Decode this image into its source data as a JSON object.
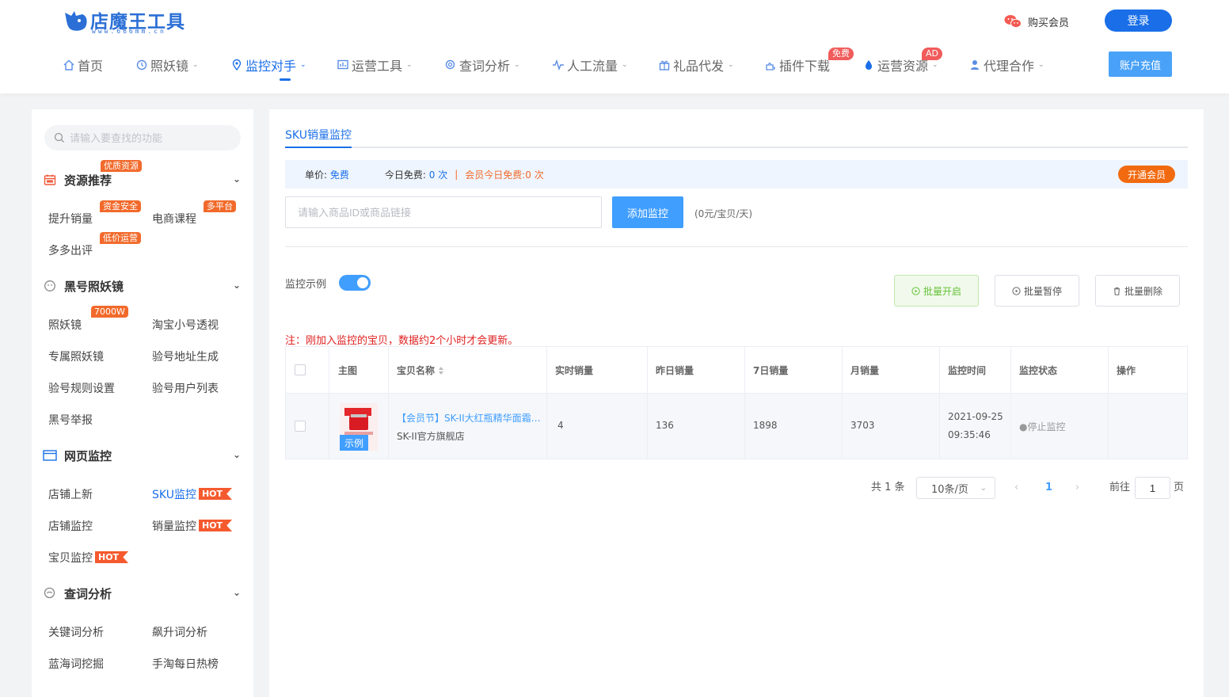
{
  "header": {
    "logo_text": "店魔王工具",
    "logo_url": "www.666mm.cn",
    "buy_vip": "购买会员",
    "login": "登录",
    "recharge": "账户充值",
    "nav": [
      {
        "label": "首页",
        "icon": "home-icon"
      },
      {
        "label": "照妖镜",
        "icon": "mirror-icon"
      },
      {
        "label": "监控对手",
        "icon": "location-icon",
        "active": true
      },
      {
        "label": "运营工具",
        "icon": "chart-icon"
      },
      {
        "label": "查词分析",
        "icon": "search-word-icon"
      },
      {
        "label": "人工流量",
        "icon": "pulse-icon"
      },
      {
        "label": "礼品代发",
        "icon": "gift-icon"
      },
      {
        "label": "插件下载",
        "icon": "puzzle-icon",
        "badge": "免费"
      },
      {
        "label": "运营资源",
        "icon": "drop-icon",
        "badge": "AD"
      },
      {
        "label": "代理合作",
        "icon": "person-icon"
      }
    ]
  },
  "sidebar": {
    "search_placeholder": "请输入要查找的功能",
    "sections": [
      {
        "title": "资源推荐",
        "tag": "优质资源",
        "icon": "calendar-icon"
      },
      {
        "title": "黑号照妖镜",
        "icon": "face-icon"
      },
      {
        "title": "网页监控",
        "icon": "window-icon"
      },
      {
        "title": "查词分析",
        "icon": "magnify-icon"
      }
    ],
    "links": {
      "tsxl": "提升销量",
      "tsxl_tag": "资金安全",
      "dskc": "电商课程",
      "dskc_tag": "多平台",
      "ddcp": "多多出评",
      "ddcp_tag": "低价运营",
      "zyj": "照妖镜",
      "zyj_tag": "7000W",
      "tbxh": "淘宝小号透视",
      "zszyj": "专属照妖镜",
      "yhdz": "验号地址生成",
      "yhgz": "验号规则设置",
      "yhyh": "验号用户列表",
      "hhjb": "黑号举报",
      "dpsx": "店铺上新",
      "skujk": "SKU监控",
      "dpjk": "店铺监控",
      "xljk": "销量监控",
      "bbjk": "宝贝监控",
      "gjc": "关键词分析",
      "bsc": "飙升词分析",
      "lhc": "蓝海词挖掘",
      "stmr": "手淘每日热榜",
      "hot": "HOT"
    }
  },
  "main": {
    "tab": "SKU销量监控",
    "info": {
      "unit_label": "单价:",
      "unit_value": "免费",
      "today_label": "今日免费:",
      "today_value": "0 次",
      "sep": "|",
      "vip_today": "会员今日免费:0 次",
      "vip_button": "开通会员"
    },
    "input_placeholder": "请输入商品ID或商品链接",
    "add_button": "添加监控",
    "price_note": "(0元/宝贝/天)",
    "example_label": "监控示例",
    "example_on": true,
    "batch_start": "批量开启",
    "batch_pause": "批量暂停",
    "batch_delete": "批量删除",
    "warning": "注：刚加入监控的宝贝，数据约2个小时才会更新。",
    "table": {
      "headers": [
        "主图",
        "宝贝名称",
        "实时销量",
        "昨日销量",
        "7日销量",
        "月销量",
        "监控时间",
        "监控状态",
        "操作"
      ],
      "rows": [
        {
          "thumb_tag": "示例",
          "name": "【会员节】SK-II大红瓶精华面霜提...",
          "shop": "SK-II官方旗舰店",
          "realtime": "4",
          "yesterday": "136",
          "week": "1898",
          "month": "3703",
          "date": "2021-09-25",
          "time": "09:35:46",
          "status": "●停止监控"
        }
      ]
    },
    "pagination": {
      "total": "共 1 条",
      "page_size": "10条/页",
      "current": "1",
      "goto": "前往",
      "goto_value": "1",
      "page": "页"
    }
  },
  "colors": {
    "primary": "#1a6fe8",
    "accent": "#409eff",
    "orange": "#f26a2b",
    "danger": "#e02020"
  }
}
